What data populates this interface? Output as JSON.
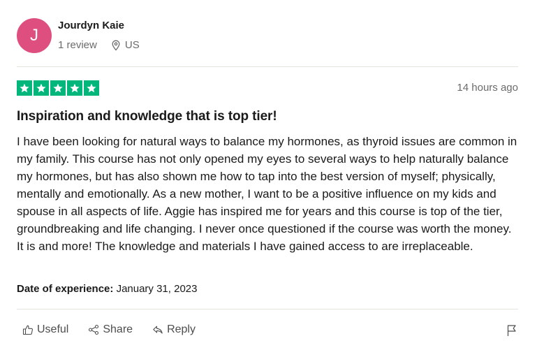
{
  "reviewer": {
    "initial": "J",
    "name": "Jourdyn Kaie",
    "review_count": "1 review",
    "location": "US",
    "avatar_color": "#de4f7f"
  },
  "review": {
    "rating": 5,
    "star_color": "#00b67a",
    "time_ago": "14 hours ago",
    "title": "Inspiration and knowledge that is top tier!",
    "body": "I have been looking for natural ways to balance my hormones, as thyroid issues are common in my family. This course has not only opened my eyes to several ways to help naturally balance my hormones, but has also shown me how to tap into the best version of myself; physically, mentally and emotionally. As a new mother, I want to be a positive influence on my kids and spouse in all aspects of life. Aggie has inspired me for years and this course is top of the tier, groundbreaking and life changing. I never once questioned if the course was worth the money. It is and more! The knowledge and materials I have gained access to are irreplaceable.",
    "date_label": "Date of experience:",
    "date_value": "January 31, 2023"
  },
  "actions": {
    "useful_label": "Useful",
    "share_label": "Share",
    "reply_label": "Reply",
    "useful_icon": "thumbs-up-icon",
    "share_icon": "share-icon",
    "reply_icon": "reply-icon",
    "flag_icon": "flag-icon"
  }
}
